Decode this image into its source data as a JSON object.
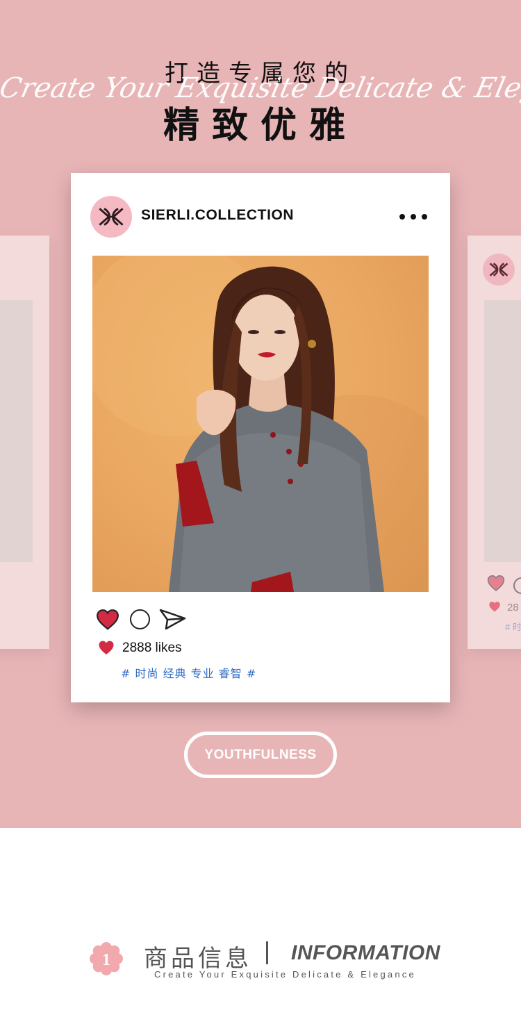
{
  "colors": {
    "hero_background": "#e8b5b7",
    "card_background": "#ffffff",
    "heart_red": "#d22b43",
    "hashtag_blue": "#2d6bc4",
    "avatar_pink": "#f5b9c3",
    "text_dark": "#111111",
    "text_gray": "#555555"
  },
  "header": {
    "title_line1": "打造专属您的",
    "title_line2": "精致优雅",
    "script_subtitle": "Create Your Exquisite Delicate & Elegance"
  },
  "post": {
    "brand_logo_icon": "sierli-logo-icon",
    "handle": "SIERLI.COLLECTION",
    "more_icon": "more-dots-icon",
    "actions": {
      "like_icon": "heart-filled-icon",
      "comment_icon": "comment-circle-icon",
      "share_icon": "paper-plane-icon"
    },
    "likes_text": "2888 likes",
    "hashtags": "# 时尚 经典 专业 睿智 #"
  },
  "side_card_right": {
    "likes_partial": "28",
    "tag_partial": "# 时"
  },
  "cta": {
    "label": "YOUTHFULNESS"
  },
  "info_section": {
    "badge_number": "1",
    "title_cn": "商品信息",
    "title_en": "INFORMATION",
    "subtitle": "Create Your Exquisite Delicate & Elegance"
  }
}
